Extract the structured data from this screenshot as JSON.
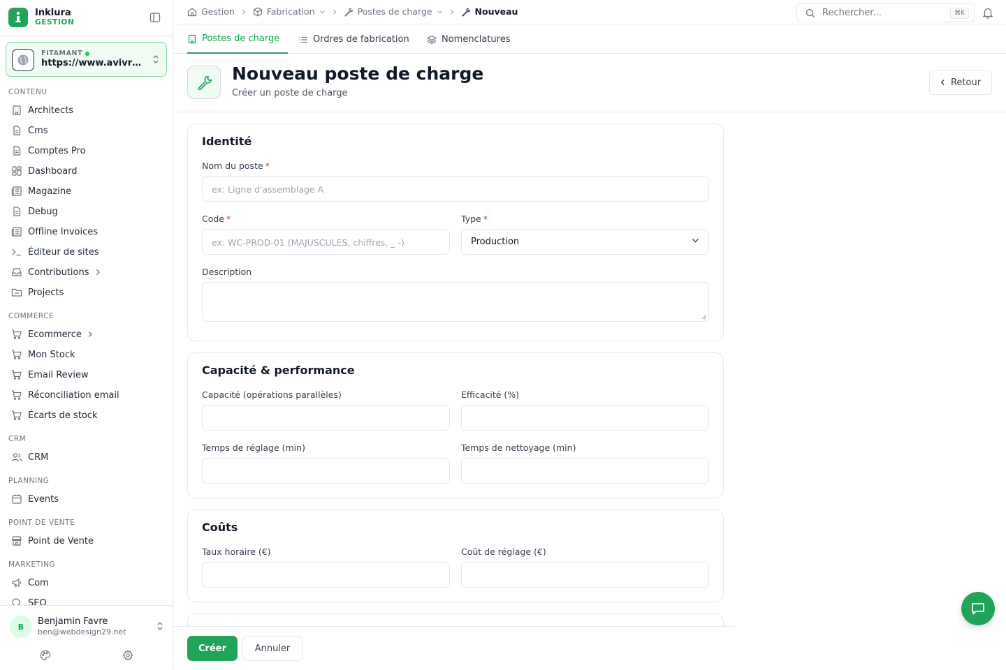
{
  "brand": {
    "name": "Inklura",
    "sub": "GESTION",
    "accent": "#22a35a"
  },
  "site": {
    "name": "FITAMANT",
    "url": "https://www.avivre.fr"
  },
  "sidebar": {
    "sections": [
      {
        "label": "CONTENU",
        "items": [
          {
            "label": "Architects",
            "icon": "building-icon"
          },
          {
            "label": "Cms",
            "icon": "file-icon"
          },
          {
            "label": "Comptes Pro",
            "icon": "file-icon"
          },
          {
            "label": "Dashboard",
            "icon": "grid-icon"
          },
          {
            "label": "Magazine",
            "icon": "newspaper-icon"
          },
          {
            "label": "Debug",
            "icon": "file-icon"
          },
          {
            "label": "Offline Invoices",
            "icon": "newspaper-icon"
          },
          {
            "label": "Éditeur de sites",
            "icon": "terminal-icon"
          },
          {
            "label": "Contributions",
            "icon": "inbox-icon",
            "expandable": true
          },
          {
            "label": "Projects",
            "icon": "folder-icon"
          }
        ]
      },
      {
        "label": "COMMERCE",
        "items": [
          {
            "label": "Ecommerce",
            "icon": "cart-icon",
            "expandable": true
          },
          {
            "label": "Mon Stock",
            "icon": "cart-icon"
          },
          {
            "label": "Email Review",
            "icon": "cart-icon"
          },
          {
            "label": "Réconciliation email",
            "icon": "cart-icon"
          },
          {
            "label": "Écarts de stock",
            "icon": "cart-icon"
          }
        ]
      },
      {
        "label": "CRM",
        "items": [
          {
            "label": "CRM",
            "icon": "users-icon"
          }
        ]
      },
      {
        "label": "PLANNING",
        "items": [
          {
            "label": "Events",
            "icon": "calendar-icon"
          }
        ]
      },
      {
        "label": "POINT DE VENTE",
        "items": [
          {
            "label": "Point de Vente",
            "icon": "store-icon"
          }
        ]
      },
      {
        "label": "MARKETING",
        "items": [
          {
            "label": "Com",
            "icon": "megaphone-icon"
          },
          {
            "label": "SEO",
            "icon": "search-icon"
          }
        ]
      }
    ]
  },
  "user": {
    "initial": "B",
    "name": "Benjamin Favre",
    "email": "ben@webdesign29.net"
  },
  "breadcrumb": [
    {
      "label": "Gestion",
      "icon": "home-icon"
    },
    {
      "label": "Fabrication",
      "icon": "box-icon",
      "dropdown": true
    },
    {
      "label": "Postes de charge",
      "icon": "wrench-icon",
      "dropdown": true
    },
    {
      "label": "Nouveau",
      "icon": "wrench-icon"
    }
  ],
  "search": {
    "placeholder": "Rechercher...",
    "shortcut": "⌘K"
  },
  "tabs": [
    {
      "label": "Postes de charge",
      "active": true
    },
    {
      "label": "Ordres de fabrication"
    },
    {
      "label": "Nomenclatures"
    }
  ],
  "header": {
    "title": "Nouveau poste de charge",
    "subtitle": "Créer un poste de charge",
    "back": "Retour"
  },
  "identity": {
    "title": "Identité",
    "name_label": "Nom du poste",
    "name_placeholder": "ex: Ligne d'assemblage A",
    "code_label": "Code",
    "code_placeholder": "ex: WC-PROD-01 (MAJUSCULES, chiffres, _ -)",
    "type_label": "Type",
    "type_value": "Production",
    "description_label": "Description"
  },
  "capacity": {
    "title": "Capacité & performance",
    "capacity_label": "Capacité (opérations parallèles)",
    "efficiency_label": "Efficacité (%)",
    "setup_label": "Temps de réglage (min)",
    "cleanup_label": "Temps de nettoyage (min)"
  },
  "costs": {
    "title": "Coûts",
    "hourly_label": "Taux horaire (€)",
    "setup_cost_label": "Coût de réglage (€)"
  },
  "actions": {
    "create": "Créer",
    "cancel": "Annuler"
  }
}
